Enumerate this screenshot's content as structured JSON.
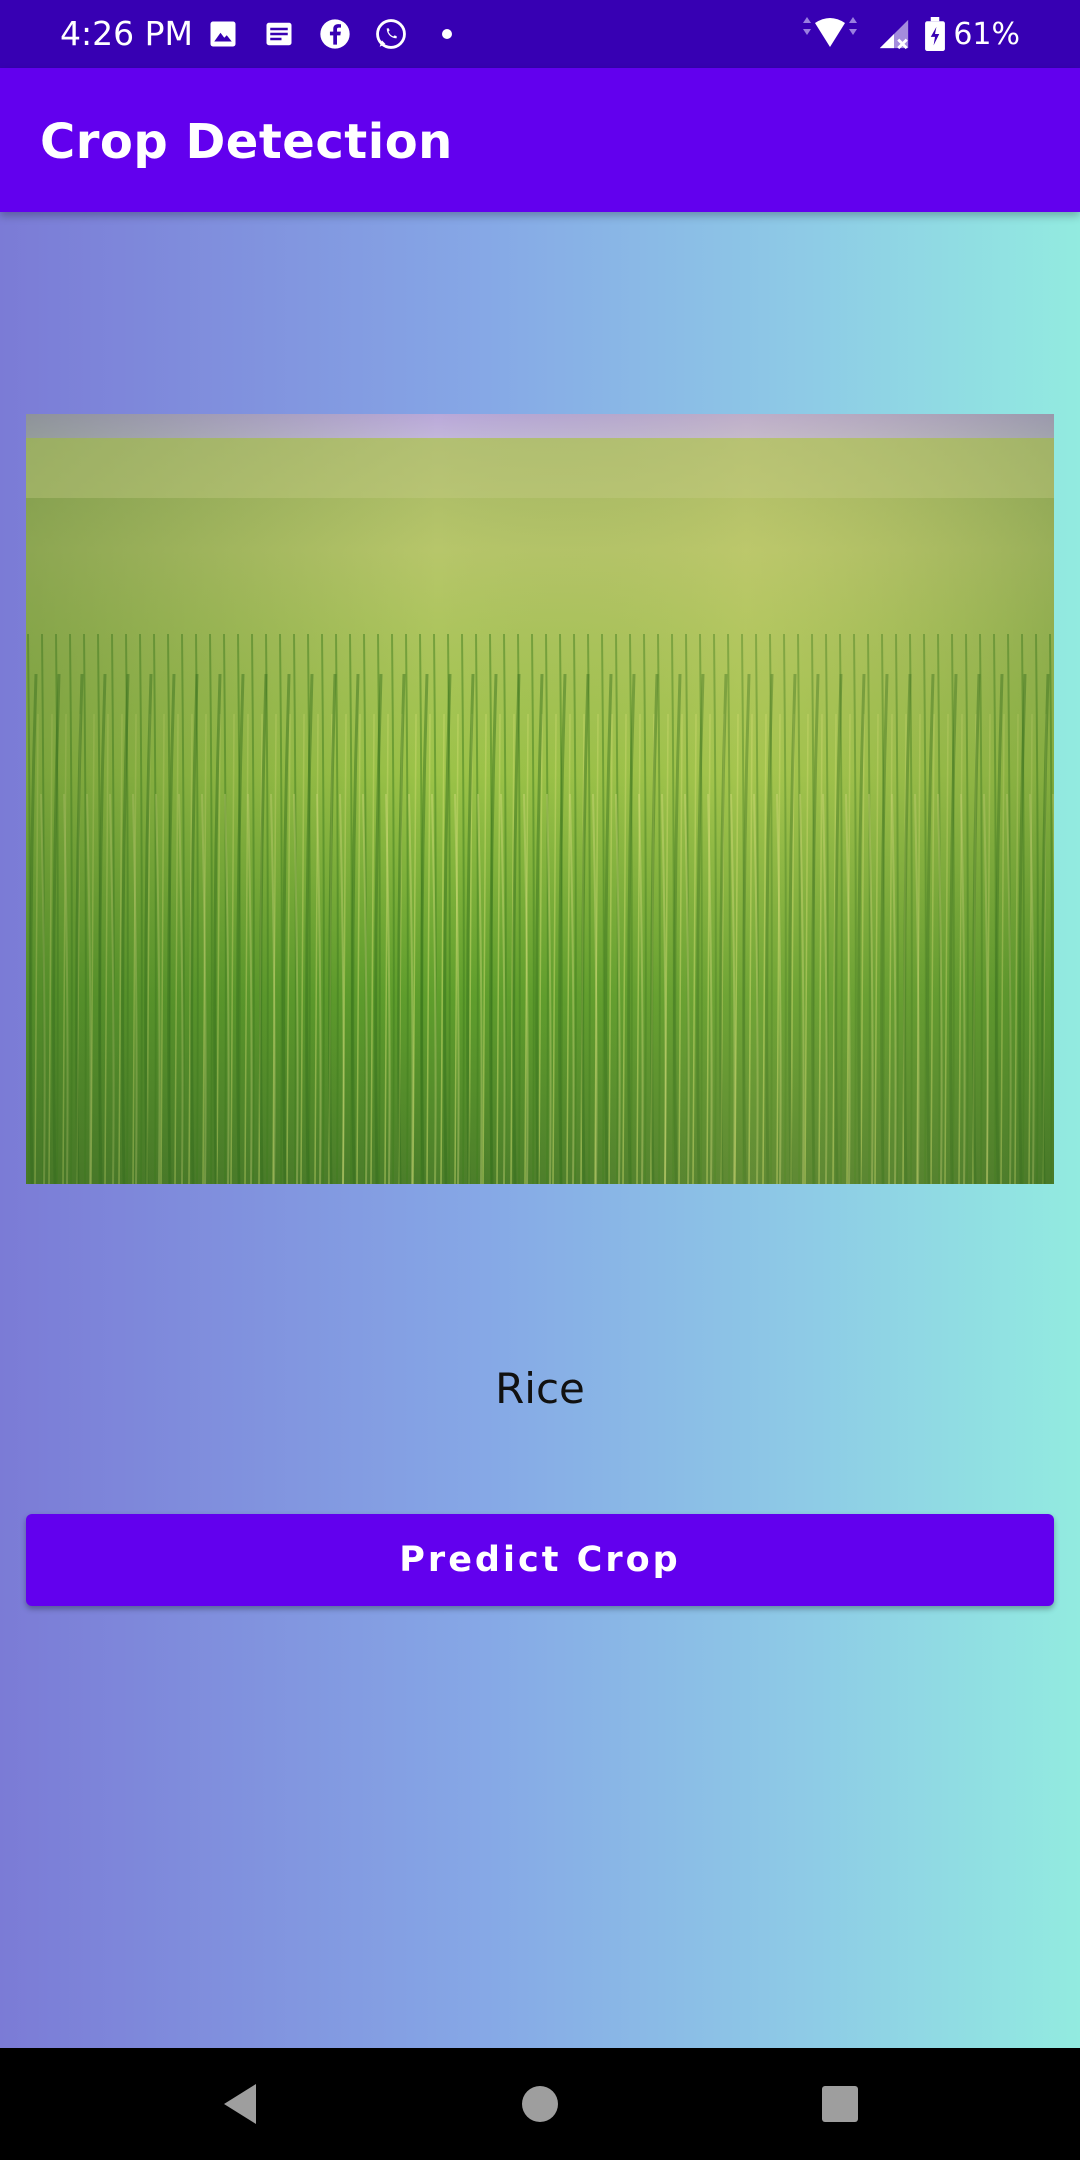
{
  "status_bar": {
    "time": "4:26 PM",
    "battery": "61%",
    "icons_left": [
      "image-icon",
      "news-icon",
      "facebook-icon",
      "whatsapp-icon",
      "dot-icon"
    ],
    "icons_right": [
      "wifi-icon",
      "signal-icon",
      "battery-icon"
    ]
  },
  "app_bar": {
    "title": "Crop Detection",
    "color": "#6200ee"
  },
  "main": {
    "image_alt": "rice field photo",
    "result": "Rice",
    "predict_button": "Predict Crop"
  },
  "nav_bar": {
    "icons": [
      "back-icon",
      "home-icon",
      "recents-icon"
    ]
  },
  "colors": {
    "status_bar": "#3700b3",
    "primary": "#6200ee",
    "gradient_start": "#7b7bd6",
    "gradient_end": "#92ebe0"
  }
}
